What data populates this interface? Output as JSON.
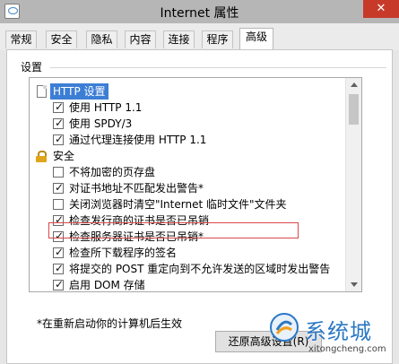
{
  "window": {
    "title": "Internet 属性",
    "close_glyph": "✕"
  },
  "tabs": [
    {
      "label": "常规"
    },
    {
      "label": "安全"
    },
    {
      "label": "隐私"
    },
    {
      "label": "内容"
    },
    {
      "label": "连接"
    },
    {
      "label": "程序"
    },
    {
      "label": "高级",
      "active": true
    }
  ],
  "settings": {
    "section_label": "设置",
    "items": [
      {
        "label": "HTTP 设置",
        "type": "header",
        "icon": "page-icon"
      },
      {
        "label": "使用 HTTP 1.1",
        "checked": true
      },
      {
        "label": "使用 SPDY/3",
        "checked": true
      },
      {
        "label": "通过代理连接使用 HTTP 1.1",
        "checked": true
      },
      {
        "label": "安全",
        "type": "header",
        "icon": "lock-icon"
      },
      {
        "label": "不将加密的页存盘",
        "checked": false
      },
      {
        "label": "对证书地址不匹配发出警告*",
        "checked": true
      },
      {
        "label": "关闭浏览器时清空\"Internet 临时文件\"文件夹",
        "checked": false,
        "highlighted": true
      },
      {
        "label": "检查发行商的证书是否已吊销",
        "checked": true
      },
      {
        "label": "检查服务器证书是否已吊销*",
        "checked": true
      },
      {
        "label": "检查所下载程序的签名",
        "checked": true
      },
      {
        "label": "将提交的 POST 重定向到不允许发送的区域时发出警告",
        "checked": true
      },
      {
        "label": "启用 DOM 存储",
        "checked": true
      }
    ]
  },
  "note": "*在重新启动你的计算机后生效",
  "reset_button": {
    "label": "还原高级设置(R)"
  },
  "watermark": {
    "brand": "系统城",
    "url": "xitongcheng.com",
    "color": "#2a78c4"
  },
  "colors": {
    "selection": "#3d7ed5",
    "annotation_red": "#d9484a",
    "titlebar": "#b6b6b6"
  }
}
